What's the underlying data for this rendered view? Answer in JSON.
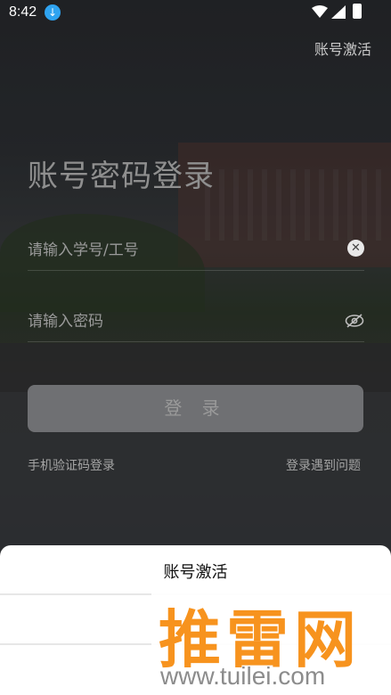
{
  "status_bar": {
    "time": "8:42"
  },
  "header": {
    "activate_label": "账号激活"
  },
  "login": {
    "title": "账号密码登录",
    "account_placeholder": "请输入学号/工号",
    "password_placeholder": "请输入密码",
    "login_button": "登 录",
    "sms_login_link": "手机验证码登录",
    "help_link": "登录遇到问题"
  },
  "bottom_sheet": {
    "title": "账号激活"
  },
  "watermark": {
    "logo_text": "推雷网",
    "url": "www.tuilei.com"
  },
  "colors": {
    "accent_download": "#2fa3f0",
    "watermark_orange": "#f7931e",
    "button_gray": "#6f7073"
  }
}
